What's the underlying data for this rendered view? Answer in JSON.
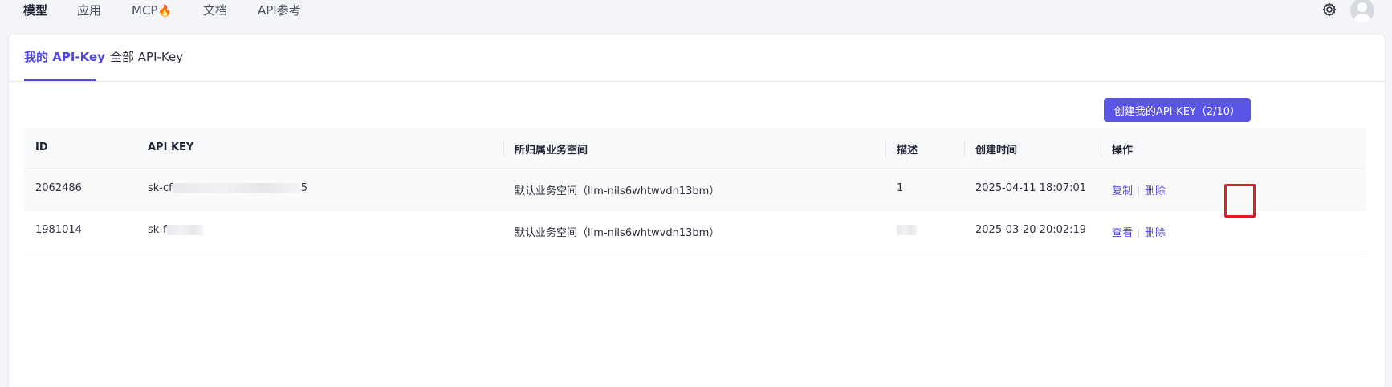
{
  "nav": {
    "items": [
      {
        "label": "模型",
        "active": true
      },
      {
        "label": "应用",
        "active": false
      },
      {
        "label": "MCP",
        "active": false,
        "badge_icon": "fire-icon"
      },
      {
        "label": "文档",
        "active": false
      },
      {
        "label": "API参考",
        "active": false
      }
    ],
    "fire_glyph": "🔥"
  },
  "tabs": [
    {
      "label": "我的 API-Key",
      "active": true
    },
    {
      "label": "全部 API-Key",
      "active": false
    }
  ],
  "create_button_label": "创建我的API-KEY（2/10）",
  "table": {
    "headers": [
      "ID",
      "API KEY",
      "所归属业务空间",
      "描述",
      "创建时间",
      "操作"
    ],
    "rows": [
      {
        "id": "2062486",
        "key_prefix": "sk-cf",
        "key_suffix": "5",
        "space": "默认业务空间（llm-nils6whtwvdn13bm）",
        "desc": "1",
        "created": "2025-04-11 18:07:01",
        "action1": "复制",
        "action2": "删除"
      },
      {
        "id": "1981014",
        "key_prefix": "sk-f",
        "key_suffix": "",
        "space": "默认业务空间（llm-nils6whtwvdn13bm）",
        "desc": "",
        "created": "2025-03-20 20:02:19",
        "action1": "查看",
        "action2": "删除"
      }
    ]
  },
  "colors": {
    "accent": "#4f46e5",
    "button": "#5b55e6",
    "highlight": "#e11d1d"
  }
}
